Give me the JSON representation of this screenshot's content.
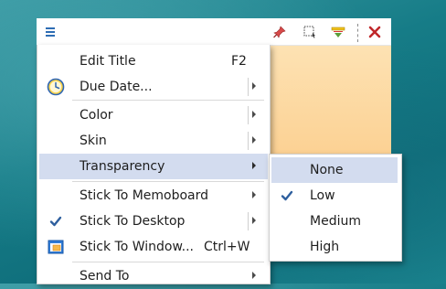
{
  "note": {
    "toolbar": {
      "menu_icon": "hamburger-menu-icon",
      "pin_icon": "pushpin-icon",
      "tools": [
        "dotted-selection-icon",
        "roll-up-icon",
        "close-icon"
      ]
    },
    "color": "#fcd7a0"
  },
  "context_menu": {
    "items": [
      {
        "label": "Edit Title",
        "shortcut": "F2"
      },
      {
        "label": "Due Date...",
        "icon": "clock-icon",
        "has_submenu": true
      },
      {
        "label": "Color",
        "has_submenu": true
      },
      {
        "label": "Skin",
        "has_submenu": true
      },
      {
        "label": "Transparency",
        "has_submenu": true,
        "highlighted": true
      },
      {
        "label": "Stick To Memoboard",
        "has_submenu": true
      },
      {
        "label": "Stick To Desktop",
        "checked": true,
        "has_submenu": true
      },
      {
        "label": "Stick To Window...",
        "shortcut": "Ctrl+W",
        "icon": "window-icon"
      },
      {
        "label": "Send To",
        "has_submenu": true
      }
    ]
  },
  "transparency_submenu": {
    "items": [
      {
        "label": "None",
        "highlighted": true
      },
      {
        "label": "Low",
        "checked": true
      },
      {
        "label": "Medium"
      },
      {
        "label": "High"
      }
    ]
  },
  "colors": {
    "highlight": "#d3dcef",
    "accent_blue": "#2e6db4",
    "note_yellow": "#fcd7a0"
  }
}
